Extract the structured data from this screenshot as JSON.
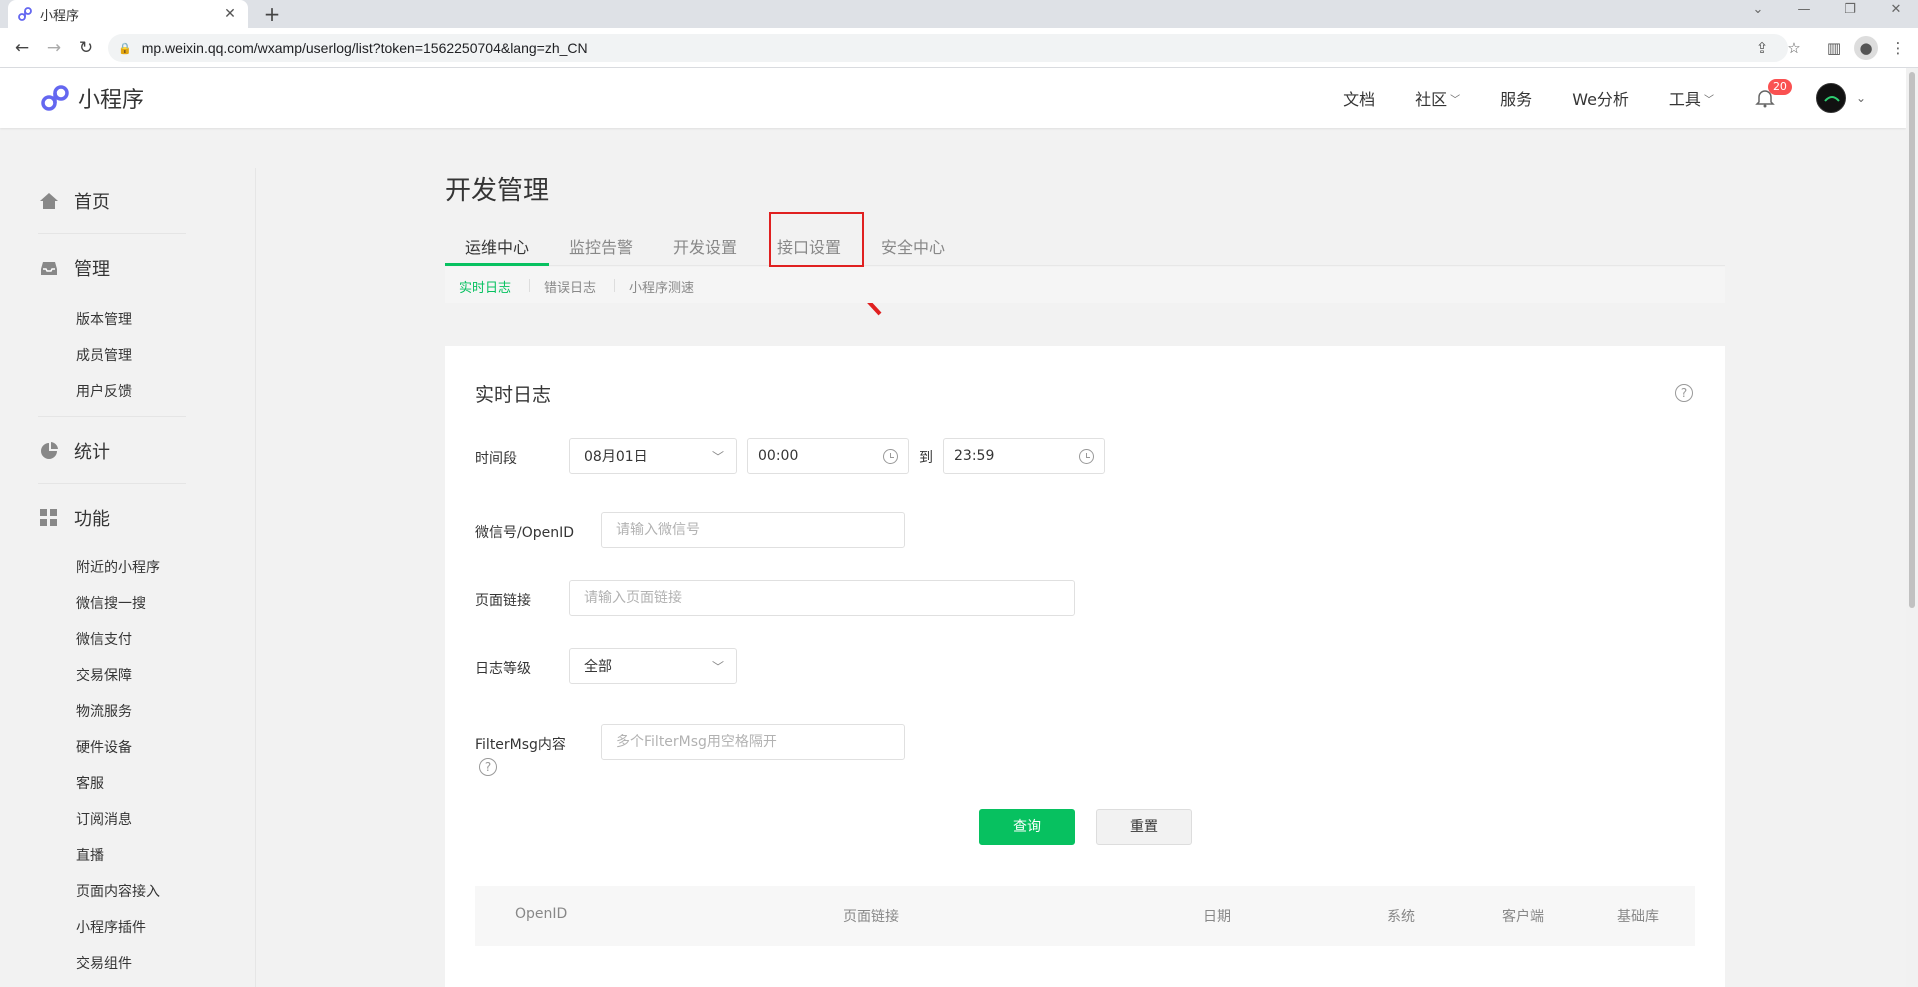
{
  "browser": {
    "tab_title": "小程序",
    "tab_close": "✕",
    "new_tab": "+",
    "url": "mp.weixin.qq.com/wxamp/userlog/list?token=1562250704&lang=zh_CN",
    "win_min": "—",
    "win_max": "❐",
    "win_close": "✕"
  },
  "header": {
    "brand": "小程序",
    "nav": [
      {
        "label": "文档"
      },
      {
        "label": "社区"
      },
      {
        "label": "服务"
      },
      {
        "label": "We分析"
      },
      {
        "label": "工具"
      }
    ],
    "notification_count": "20",
    "colors": {
      "accent": "#07c160",
      "brand": "#6467f0",
      "badge": "#fa5151"
    }
  },
  "sidebar": {
    "groups": [
      {
        "label": "首页",
        "icon": "home-icon"
      },
      {
        "label": "管理",
        "icon": "inbox-icon",
        "items": [
          "版本管理",
          "成员管理",
          "用户反馈"
        ]
      },
      {
        "label": "统计",
        "icon": "pie-chart-icon"
      },
      {
        "label": "功能",
        "icon": "grid-icon",
        "items": [
          "附近的小程序",
          "微信搜一搜",
          "微信支付",
          "交易保障",
          "物流服务",
          "硬件设备",
          "客服",
          "订阅消息",
          "直播",
          "页面内容接入",
          "小程序插件",
          "交易组件"
        ]
      }
    ]
  },
  "main": {
    "title": "开发管理",
    "tabs": [
      "运维中心",
      "监控告警",
      "开发设置",
      "接口设置",
      "安全中心"
    ],
    "subtabs": [
      "实时日志",
      "错误日志",
      "小程序测速"
    ],
    "card": {
      "title": "实时日志",
      "help": "?",
      "time_label": "时间段",
      "date_value": "08月01日",
      "start_time": "00:00",
      "to_label": "到",
      "end_time": "23:59",
      "openid_label": "微信号/OpenID",
      "openid_placeholder": "请输入微信号",
      "page_label": "页面链接",
      "page_placeholder": "请输入页面链接",
      "level_label": "日志等级",
      "level_value": "全部",
      "filter_label": "FilterMsg内容",
      "filter_placeholder": "多个FilterMsg用空格隔开",
      "query_button": "查询",
      "reset_button": "重置",
      "table_headers": [
        "OpenID",
        "页面链接",
        "日期",
        "系统",
        "客户端",
        "基础库"
      ]
    }
  }
}
